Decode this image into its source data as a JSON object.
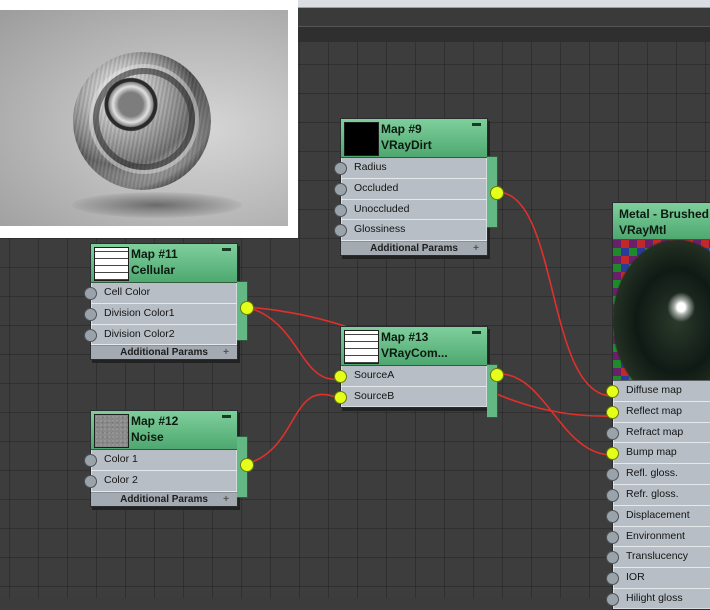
{
  "preview": {
    "caption": ""
  },
  "nodes": {
    "dirt": {
      "title": "Map #9",
      "subtitle": "VRayDirt",
      "params": [
        "Radius",
        "Occluded",
        "Unoccluded",
        "Glossiness"
      ],
      "footer": "Additional Params",
      "footer_icon": "+"
    },
    "cellular": {
      "title": "Map #11",
      "subtitle": "Cellular",
      "params": [
        "Cell Color",
        "Division Color1",
        "Division Color2"
      ],
      "footer": "Additional Params",
      "footer_icon": "+"
    },
    "noise": {
      "title": "Map #12",
      "subtitle": "Noise",
      "params": [
        "Color 1",
        "Color 2"
      ],
      "footer": "Additional Params",
      "footer_icon": "+"
    },
    "comp": {
      "title": "Map #13",
      "subtitle": "VRayCom...",
      "params": [
        "SourceA",
        "SourceB"
      ]
    },
    "material": {
      "title": "Metal - Brushed",
      "subtitle": "VRayMtl",
      "params": [
        "Diffuse map",
        "Reflect map",
        "Refract map",
        "Bump map",
        "Refl. gloss.",
        "Refr. gloss.",
        "Displacement",
        "Environment",
        "Translucency",
        "IOR",
        "Hilight gloss"
      ]
    }
  },
  "colors": {
    "node_header": "#5cb87f",
    "node_body": "#b7bec5",
    "socket_active": "#e4ff1a",
    "socket_idle": "#9aa2aa",
    "wire": "#e0302c",
    "canvas": "#3d3d3d"
  }
}
